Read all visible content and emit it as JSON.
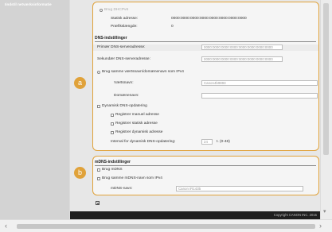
{
  "nav": {
    "item": "Iindstil netværksinformatie"
  },
  "panel_a": {
    "badge": "a",
    "ipv6_use": "Brug DHCPv6",
    "stateful_label": "Statisk adresse:",
    "stateful_value": "0000:0000:0000:0000:0000:0000:0000:0000",
    "prefix_label": "Præfikslængde:",
    "prefix_value": "0",
    "dns_title": "DNS-indstillinger",
    "primary_label": "Primær DNS-serveradresse:",
    "primary_value": "0000:0000:0000:0000:0000:0000:0000:0000",
    "secondary_label": "Sekundær DNS-serveradresse:",
    "secondary_value": "0000:0000:0000:0000:0000:0000:0000:0000",
    "same_host_label": "Brug samme værtsnavn/domænenavn som IPv4",
    "host_label": "Værtsnavn:",
    "host_value": "Canon4b9893",
    "domain_label": "Domænenavn:",
    "domain_value": "",
    "dyn_label": "Dynamisk DNS-opdatering",
    "reg_manual": "Registrer manuel adresse",
    "reg_static": "Registrer statisk adresse",
    "reg_dynamic": "Registrer dynamisk adresse",
    "interval_label": "Interval for dynamisk DNS-opdatering:",
    "interval_value": "24",
    "interval_unit": "t. (0-48)"
  },
  "panel_b": {
    "badge": "b",
    "title": "mDNS-indstillinger",
    "use_label": "Brug mDNS",
    "same_label": "Brug samme mDNS-navn som IPv4",
    "name_label": "mDNS-navn:",
    "name_value": "Canon iR1435"
  },
  "footer": {
    "copyright": "Copyright CANON INC. 2015"
  }
}
